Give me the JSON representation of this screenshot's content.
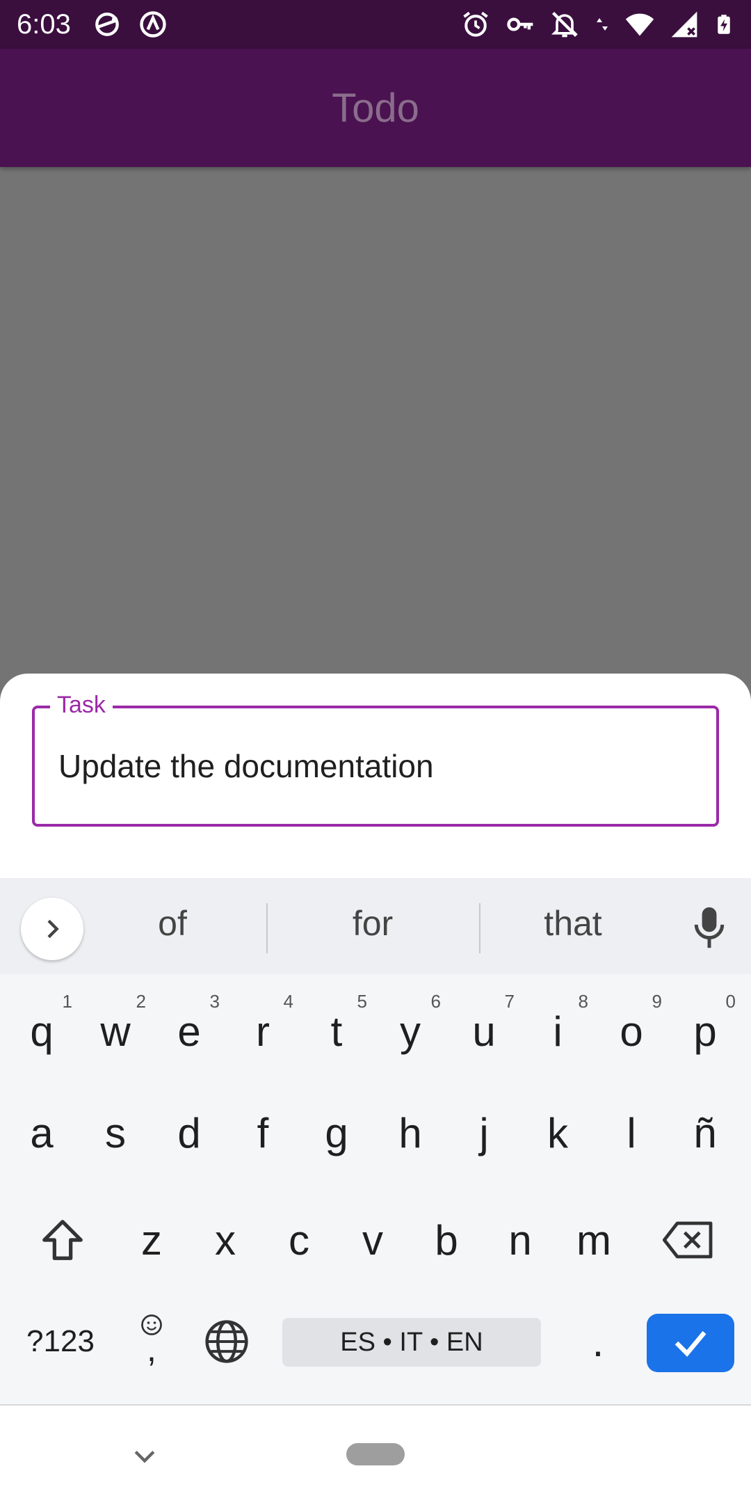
{
  "status_bar": {
    "time": "6:03",
    "left_icons": [
      "sync-icon",
      "assistant-icon"
    ],
    "right_icons": [
      "alarm-icon",
      "vpn-key-icon",
      "notifications-off-icon",
      "data-arrows-icon",
      "wifi-icon",
      "signal-icon",
      "battery-charging-icon"
    ]
  },
  "app_bar": {
    "title": "Todo"
  },
  "task_field": {
    "label": "Task",
    "value": "Update the documentation"
  },
  "keyboard": {
    "suggestions": [
      "of",
      "for",
      "that"
    ],
    "row1": [
      {
        "key": "q",
        "hint": "1"
      },
      {
        "key": "w",
        "hint": "2"
      },
      {
        "key": "e",
        "hint": "3"
      },
      {
        "key": "r",
        "hint": "4"
      },
      {
        "key": "t",
        "hint": "5"
      },
      {
        "key": "y",
        "hint": "6"
      },
      {
        "key": "u",
        "hint": "7"
      },
      {
        "key": "i",
        "hint": "8"
      },
      {
        "key": "o",
        "hint": "9"
      },
      {
        "key": "p",
        "hint": "0"
      }
    ],
    "row2": [
      "a",
      "s",
      "d",
      "f",
      "g",
      "h",
      "j",
      "k",
      "l",
      "ñ"
    ],
    "row3": [
      "z",
      "x",
      "c",
      "v",
      "b",
      "n",
      "m"
    ],
    "symbols_label": "?123",
    "comma_label": ",",
    "space_label": "ES • IT • EN",
    "period_label": "."
  },
  "colors": {
    "status_bar": "#3a0f3e",
    "app_bar": "#4a1250",
    "accent": "#9b2aa8",
    "enter_key": "#1a73e8",
    "scrim": "#747474"
  }
}
